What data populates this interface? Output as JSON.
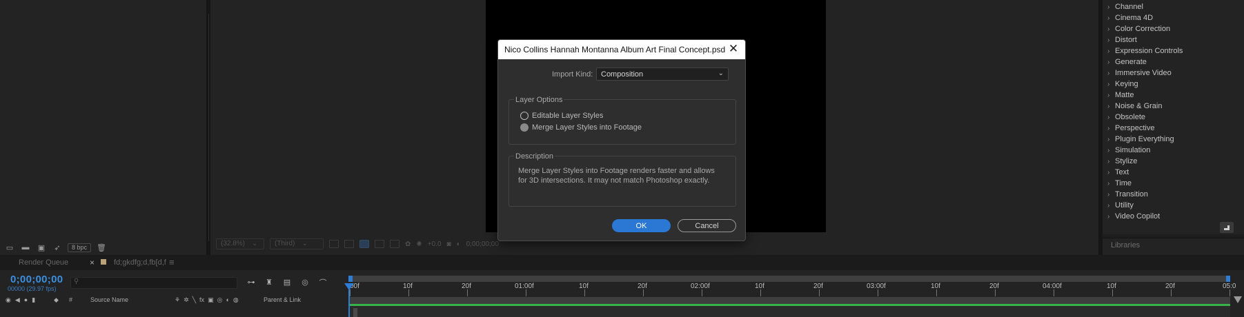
{
  "project": {
    "bpc": "8 bpc"
  },
  "viewer": {
    "zoom": "(32.8%)",
    "view": "(Third)",
    "exposure": "+0.0",
    "timecode": "0;00;00;00"
  },
  "effects": {
    "items": [
      "Channel",
      "Cinema 4D",
      "Color Correction",
      "Distort",
      "Expression Controls",
      "Generate",
      "Immersive Video",
      "Keying",
      "Matte",
      "Noise & Grain",
      "Obsolete",
      "Perspective",
      "Plugin Everything",
      "Simulation",
      "Stylize",
      "Text",
      "Time",
      "Transition",
      "Utility",
      "Video Copilot"
    ]
  },
  "libraries": {
    "label": "Libraries"
  },
  "tabs": {
    "render_queue": "Render Queue",
    "close": "×",
    "comp_name": "fd;gkdfg;d,fb[d,f",
    "menu": "≡"
  },
  "timeline": {
    "timecode": "0;00;00;00",
    "fps": "00000 (29.97 fps)",
    "columns": {
      "num": "#",
      "source_name": "Source Name",
      "parent_link": "Parent & Link"
    },
    "ruler_labels": [
      "00f",
      "10f",
      "20f",
      "01:00f",
      "10f",
      "20f",
      "02:00f",
      "10f",
      "20f",
      "03:00f",
      "10f",
      "20f",
      "04:00f",
      "10f",
      "20f",
      "05:0"
    ]
  },
  "dialog": {
    "title": "Nico Collins Hannah Montanna Album Art Final Concept.psd",
    "close": "✕",
    "import_kind_label": "Import Kind:",
    "import_kind_value": "Composition",
    "layer_options_title": "Layer Options",
    "option_editable": "Editable Layer Styles",
    "option_merge": "Merge Layer Styles into Footage",
    "selected_option": "Merge Layer Styles into Footage",
    "description_title": "Description",
    "description_text": "Merge Layer Styles into Footage renders faster and allows for 3D intersections. It may not match Photoshop exactly.",
    "ok_label": "OK",
    "cancel_label": "Cancel"
  },
  "colors": {
    "accent_blue": "#2b78d4",
    "timecode_blue": "#3c8fe0",
    "bar_green": "#37b34a"
  }
}
